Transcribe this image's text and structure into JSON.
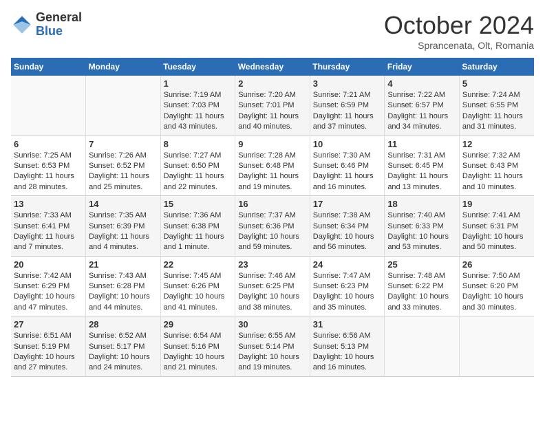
{
  "header": {
    "logo_general": "General",
    "logo_blue": "Blue",
    "month_title": "October 2024",
    "location": "Sprancenata, Olt, Romania"
  },
  "calendar": {
    "weekdays": [
      "Sunday",
      "Monday",
      "Tuesday",
      "Wednesday",
      "Thursday",
      "Friday",
      "Saturday"
    ],
    "weeks": [
      [
        {
          "day": "",
          "sunrise": "",
          "sunset": "",
          "daylight": ""
        },
        {
          "day": "",
          "sunrise": "",
          "sunset": "",
          "daylight": ""
        },
        {
          "day": "1",
          "sunrise": "Sunrise: 7:19 AM",
          "sunset": "Sunset: 7:03 PM",
          "daylight": "Daylight: 11 hours and 43 minutes."
        },
        {
          "day": "2",
          "sunrise": "Sunrise: 7:20 AM",
          "sunset": "Sunset: 7:01 PM",
          "daylight": "Daylight: 11 hours and 40 minutes."
        },
        {
          "day": "3",
          "sunrise": "Sunrise: 7:21 AM",
          "sunset": "Sunset: 6:59 PM",
          "daylight": "Daylight: 11 hours and 37 minutes."
        },
        {
          "day": "4",
          "sunrise": "Sunrise: 7:22 AM",
          "sunset": "Sunset: 6:57 PM",
          "daylight": "Daylight: 11 hours and 34 minutes."
        },
        {
          "day": "5",
          "sunrise": "Sunrise: 7:24 AM",
          "sunset": "Sunset: 6:55 PM",
          "daylight": "Daylight: 11 hours and 31 minutes."
        }
      ],
      [
        {
          "day": "6",
          "sunrise": "Sunrise: 7:25 AM",
          "sunset": "Sunset: 6:53 PM",
          "daylight": "Daylight: 11 hours and 28 minutes."
        },
        {
          "day": "7",
          "sunrise": "Sunrise: 7:26 AM",
          "sunset": "Sunset: 6:52 PM",
          "daylight": "Daylight: 11 hours and 25 minutes."
        },
        {
          "day": "8",
          "sunrise": "Sunrise: 7:27 AM",
          "sunset": "Sunset: 6:50 PM",
          "daylight": "Daylight: 11 hours and 22 minutes."
        },
        {
          "day": "9",
          "sunrise": "Sunrise: 7:28 AM",
          "sunset": "Sunset: 6:48 PM",
          "daylight": "Daylight: 11 hours and 19 minutes."
        },
        {
          "day": "10",
          "sunrise": "Sunrise: 7:30 AM",
          "sunset": "Sunset: 6:46 PM",
          "daylight": "Daylight: 11 hours and 16 minutes."
        },
        {
          "day": "11",
          "sunrise": "Sunrise: 7:31 AM",
          "sunset": "Sunset: 6:45 PM",
          "daylight": "Daylight: 11 hours and 13 minutes."
        },
        {
          "day": "12",
          "sunrise": "Sunrise: 7:32 AM",
          "sunset": "Sunset: 6:43 PM",
          "daylight": "Daylight: 11 hours and 10 minutes."
        }
      ],
      [
        {
          "day": "13",
          "sunrise": "Sunrise: 7:33 AM",
          "sunset": "Sunset: 6:41 PM",
          "daylight": "Daylight: 11 hours and 7 minutes."
        },
        {
          "day": "14",
          "sunrise": "Sunrise: 7:35 AM",
          "sunset": "Sunset: 6:39 PM",
          "daylight": "Daylight: 11 hours and 4 minutes."
        },
        {
          "day": "15",
          "sunrise": "Sunrise: 7:36 AM",
          "sunset": "Sunset: 6:38 PM",
          "daylight": "Daylight: 11 hours and 1 minute."
        },
        {
          "day": "16",
          "sunrise": "Sunrise: 7:37 AM",
          "sunset": "Sunset: 6:36 PM",
          "daylight": "Daylight: 10 hours and 59 minutes."
        },
        {
          "day": "17",
          "sunrise": "Sunrise: 7:38 AM",
          "sunset": "Sunset: 6:34 PM",
          "daylight": "Daylight: 10 hours and 56 minutes."
        },
        {
          "day": "18",
          "sunrise": "Sunrise: 7:40 AM",
          "sunset": "Sunset: 6:33 PM",
          "daylight": "Daylight: 10 hours and 53 minutes."
        },
        {
          "day": "19",
          "sunrise": "Sunrise: 7:41 AM",
          "sunset": "Sunset: 6:31 PM",
          "daylight": "Daylight: 10 hours and 50 minutes."
        }
      ],
      [
        {
          "day": "20",
          "sunrise": "Sunrise: 7:42 AM",
          "sunset": "Sunset: 6:29 PM",
          "daylight": "Daylight: 10 hours and 47 minutes."
        },
        {
          "day": "21",
          "sunrise": "Sunrise: 7:43 AM",
          "sunset": "Sunset: 6:28 PM",
          "daylight": "Daylight: 10 hours and 44 minutes."
        },
        {
          "day": "22",
          "sunrise": "Sunrise: 7:45 AM",
          "sunset": "Sunset: 6:26 PM",
          "daylight": "Daylight: 10 hours and 41 minutes."
        },
        {
          "day": "23",
          "sunrise": "Sunrise: 7:46 AM",
          "sunset": "Sunset: 6:25 PM",
          "daylight": "Daylight: 10 hours and 38 minutes."
        },
        {
          "day": "24",
          "sunrise": "Sunrise: 7:47 AM",
          "sunset": "Sunset: 6:23 PM",
          "daylight": "Daylight: 10 hours and 35 minutes."
        },
        {
          "day": "25",
          "sunrise": "Sunrise: 7:48 AM",
          "sunset": "Sunset: 6:22 PM",
          "daylight": "Daylight: 10 hours and 33 minutes."
        },
        {
          "day": "26",
          "sunrise": "Sunrise: 7:50 AM",
          "sunset": "Sunset: 6:20 PM",
          "daylight": "Daylight: 10 hours and 30 minutes."
        }
      ],
      [
        {
          "day": "27",
          "sunrise": "Sunrise: 6:51 AM",
          "sunset": "Sunset: 5:19 PM",
          "daylight": "Daylight: 10 hours and 27 minutes."
        },
        {
          "day": "28",
          "sunrise": "Sunrise: 6:52 AM",
          "sunset": "Sunset: 5:17 PM",
          "daylight": "Daylight: 10 hours and 24 minutes."
        },
        {
          "day": "29",
          "sunrise": "Sunrise: 6:54 AM",
          "sunset": "Sunset: 5:16 PM",
          "daylight": "Daylight: 10 hours and 21 minutes."
        },
        {
          "day": "30",
          "sunrise": "Sunrise: 6:55 AM",
          "sunset": "Sunset: 5:14 PM",
          "daylight": "Daylight: 10 hours and 19 minutes."
        },
        {
          "day": "31",
          "sunrise": "Sunrise: 6:56 AM",
          "sunset": "Sunset: 5:13 PM",
          "daylight": "Daylight: 10 hours and 16 minutes."
        },
        {
          "day": "",
          "sunrise": "",
          "sunset": "",
          "daylight": ""
        },
        {
          "day": "",
          "sunrise": "",
          "sunset": "",
          "daylight": ""
        }
      ]
    ]
  }
}
